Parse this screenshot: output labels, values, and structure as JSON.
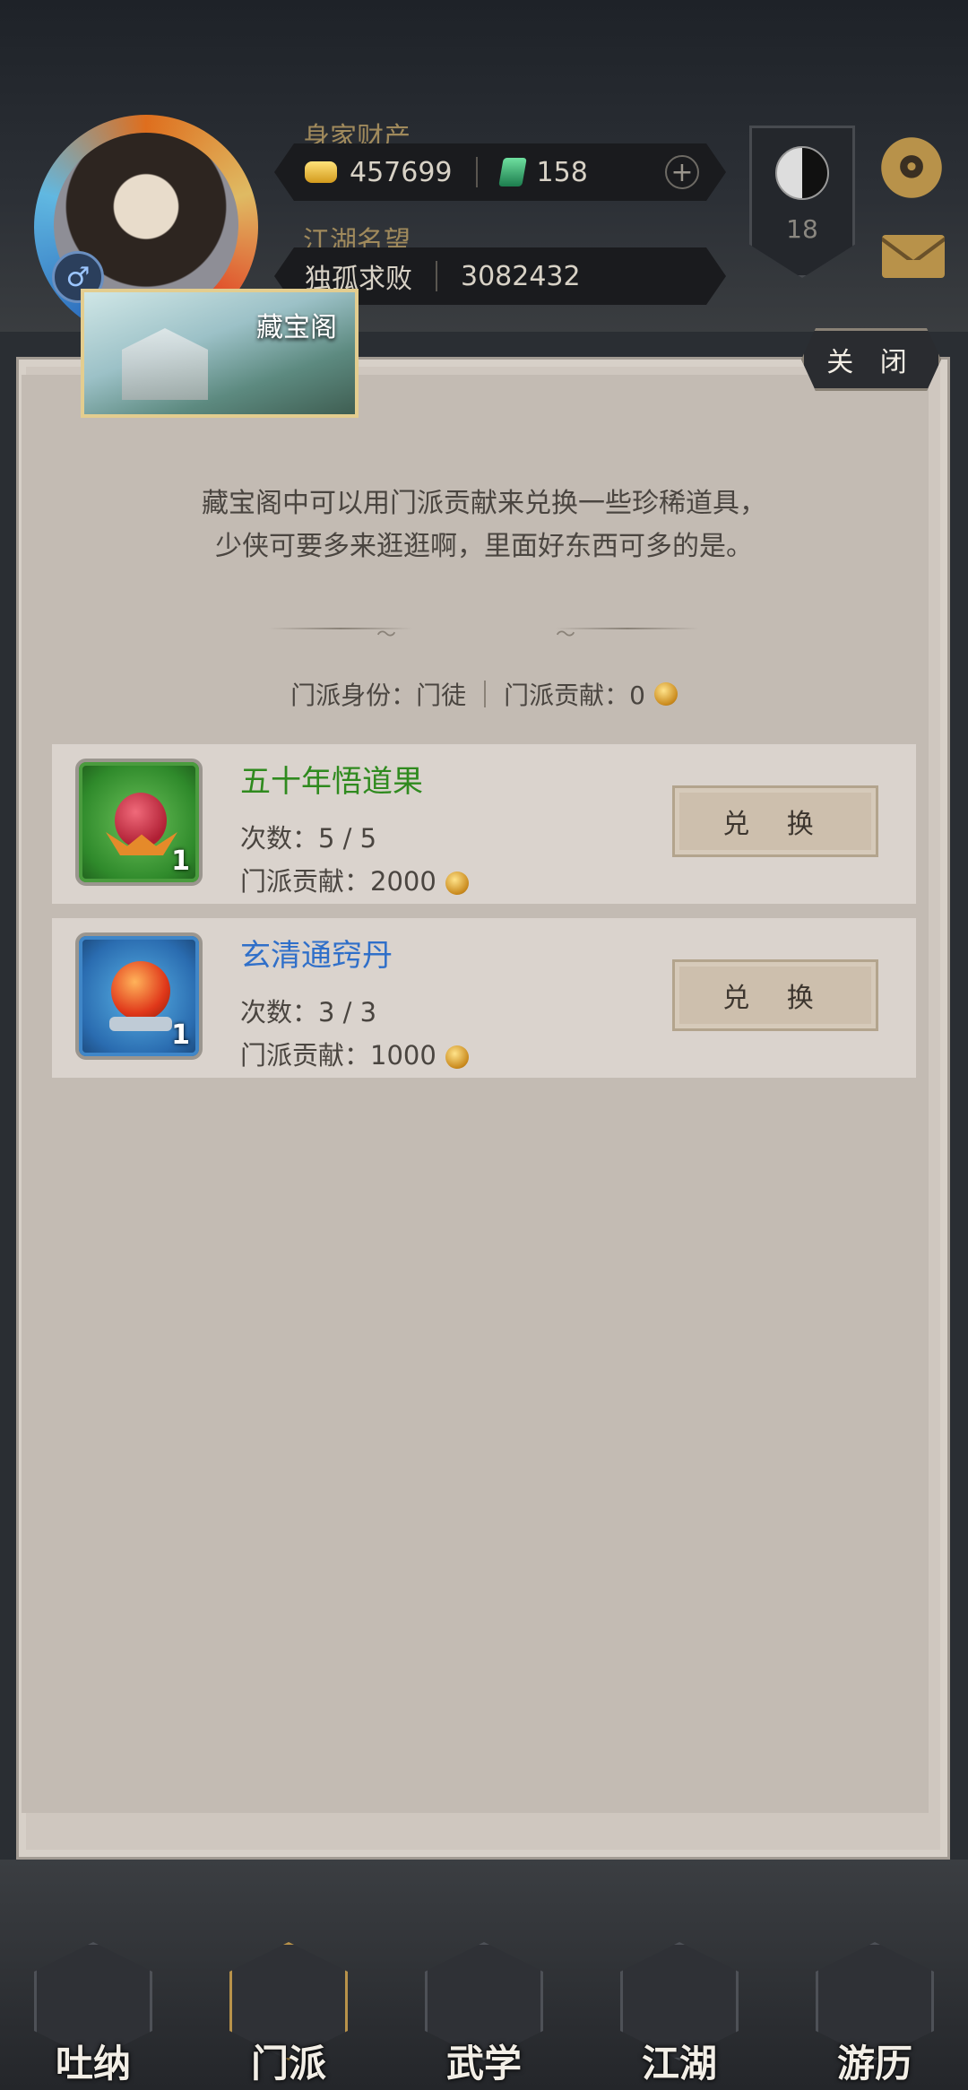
{
  "header": {
    "wealth_label": "身家财产",
    "gold_amount": "457699",
    "jade_amount": "158",
    "fame_label": "江湖名望",
    "title": "独孤求败",
    "fame_value": "3082432",
    "level": "18"
  },
  "panel": {
    "thumb_title": "藏宝阁",
    "close_label": "关 闭",
    "description_line1": "藏宝阁中可以用门派贡献来兑换一些珍稀道具，",
    "description_line2": "少侠可要多来逛逛啊，里面好东西可多的是。",
    "identity": "门派身份：门徒",
    "contribution": "门派贡献：0"
  },
  "items": [
    {
      "name": "五十年悟道果",
      "times": "次数：5 / 5",
      "cost": "门派贡献：2000",
      "qty": "1",
      "button": "兑 换"
    },
    {
      "name": "玄清通窍丹",
      "times": "次数：3 / 3",
      "cost": "门派贡献：1000",
      "qty": "1",
      "button": "兑 换"
    }
  ],
  "nav": {
    "items": [
      {
        "label": "吐纳"
      },
      {
        "label": "门派"
      },
      {
        "label": "武学"
      },
      {
        "label": "江湖"
      },
      {
        "label": "游历"
      }
    ]
  },
  "colors": {
    "panel_bg": "#cfc7bf",
    "item_green": "#2f8a1e",
    "item_blue": "#2f6fc9",
    "accent_gold": "#b8924a"
  },
  "icons": [
    "gold-icon",
    "jade-icon",
    "plus-icon",
    "taiji-icon",
    "gear-icon",
    "mail-icon",
    "coin-icon",
    "gender-male-icon"
  ]
}
